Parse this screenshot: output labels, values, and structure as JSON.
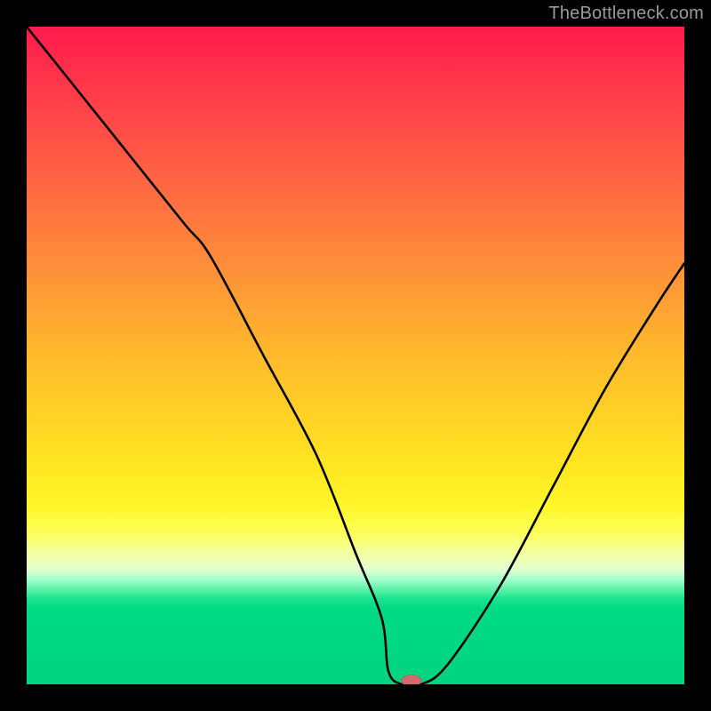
{
  "watermark": "TheBottleneck.com",
  "chart_data": {
    "type": "line",
    "title": "",
    "xlabel": "",
    "ylabel": "",
    "xlim": [
      0,
      100
    ],
    "ylim": [
      0,
      100
    ],
    "curve": {
      "name": "bottleneck-curve",
      "x": [
        0,
        8,
        16,
        24,
        28,
        36,
        44,
        50,
        54,
        55,
        57,
        60,
        64,
        72,
        80,
        88,
        96,
        100
      ],
      "y": [
        100,
        90,
        80,
        70,
        65,
        50,
        35,
        20,
        10,
        2,
        0,
        0,
        3,
        15,
        30,
        45,
        58,
        64
      ]
    },
    "marker": {
      "name": "optimal-point",
      "x": 58.5,
      "y": 0,
      "color": "#d46a6a",
      "rx": 10,
      "ry": 6
    },
    "gradient_stops": [
      {
        "pos": 0,
        "color": "#ff1a4d"
      },
      {
        "pos": 0.5,
        "color": "#ffba2c"
      },
      {
        "pos": 0.77,
        "color": "#fcff5a"
      },
      {
        "pos": 0.88,
        "color": "#00db84"
      },
      {
        "pos": 1.0,
        "color": "#00d482"
      }
    ]
  }
}
